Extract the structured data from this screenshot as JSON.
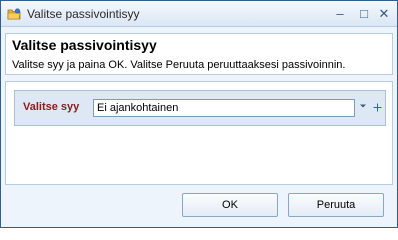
{
  "window": {
    "title": "Valitse passivointisyy",
    "minimize_glyph": "–",
    "maximize_glyph": "□",
    "close_glyph": "✕"
  },
  "header": {
    "title": "Valitse passivointisyy",
    "subtitle": "Valitse syy ja paina OK. Valitse Peruuta peruuttaaksesi passivoinnin."
  },
  "form": {
    "reason_label": "Valitse syy",
    "reason_value": "Ei ajankohtainen",
    "dropdown_icon": "chevron-down-icon",
    "add_icon": "plus-icon"
  },
  "buttons": {
    "ok_label": "OK",
    "cancel_label": "Peruuta"
  },
  "colors": {
    "label_accent": "#8b1c1c",
    "window_border": "#2f5f8f",
    "panel_bg": "#eef4fb"
  }
}
